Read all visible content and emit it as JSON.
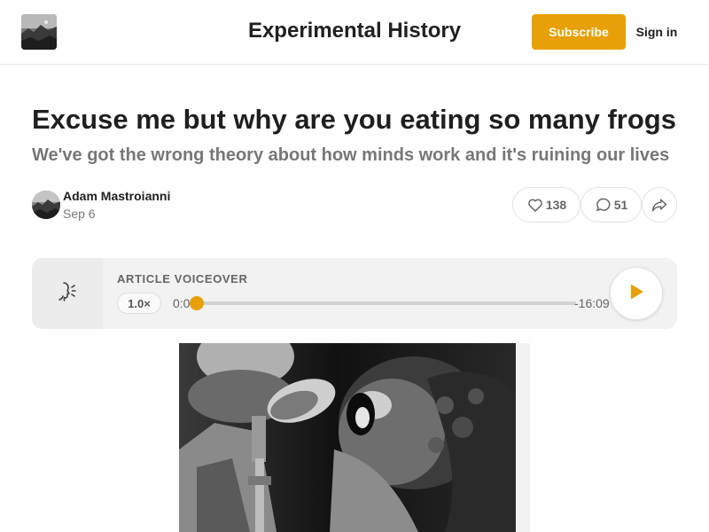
{
  "header": {
    "site_title": "Experimental History",
    "subscribe_label": "Subscribe",
    "signin_label": "Sign in",
    "accent_color": "#e8a008"
  },
  "post": {
    "title": "Excuse me but why are you eating so many frogs",
    "subtitle": "We've got the wrong theory about how minds work and it's ruining our lives",
    "author": "Adam Mastroianni",
    "date": "Sep 6",
    "likes": "138",
    "comments": "51"
  },
  "player": {
    "label": "ARTICLE VOICEOVER",
    "speed": "1.0×",
    "elapsed": "0:00",
    "remaining": "-16:09",
    "progress": 0
  },
  "icons": {
    "like": "heart-icon",
    "comment": "comment-icon",
    "share": "share-icon",
    "voiceover": "voiceover-icon",
    "play": "play-icon"
  }
}
